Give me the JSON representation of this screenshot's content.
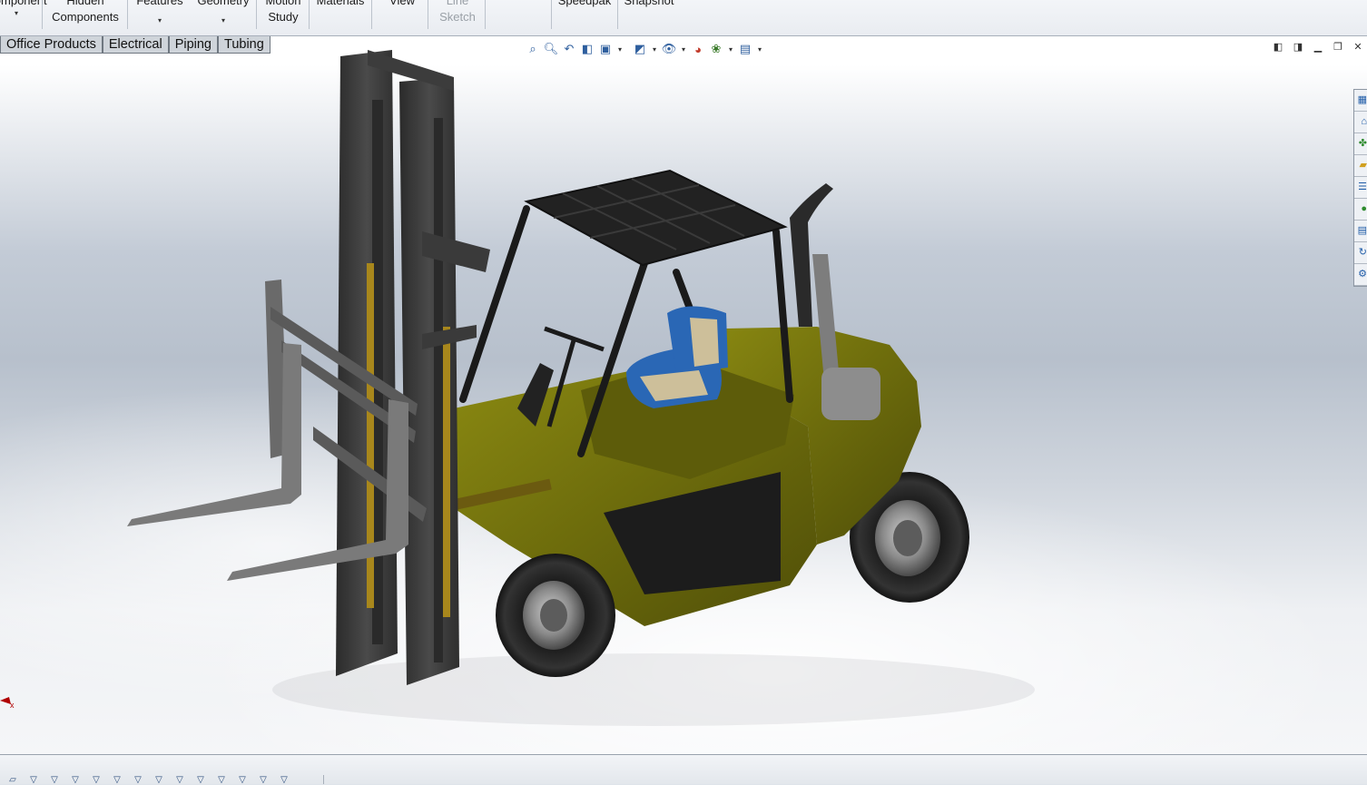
{
  "ribbon": {
    "buttons": [
      {
        "label1": "Component",
        "label2": "",
        "has_dropdown": true,
        "disabled": false
      },
      {
        "label1": "Hidden",
        "label2": "Components",
        "has_dropdown": false,
        "disabled": false
      },
      {
        "label1": "Features",
        "label2": "",
        "has_dropdown": true,
        "disabled": false
      },
      {
        "label1": "Geometry",
        "label2": "",
        "has_dropdown": true,
        "disabled": false
      },
      {
        "label1": "Motion",
        "label2": "Study",
        "has_dropdown": false,
        "disabled": false
      },
      {
        "label1": "Materials",
        "label2": "",
        "has_dropdown": false,
        "disabled": false
      },
      {
        "label1": "View",
        "label2": "",
        "has_dropdown": false,
        "disabled": false
      },
      {
        "label1": "Line",
        "label2": "Sketch",
        "has_dropdown": false,
        "disabled": true
      },
      {
        "label1": "Speedpak",
        "label2": "",
        "has_dropdown": false,
        "disabled": false
      },
      {
        "label1": "Snapshot",
        "label2": "",
        "has_dropdown": false,
        "disabled": false
      }
    ]
  },
  "tabs": [
    "Office Products",
    "Electrical",
    "Piping",
    "Tubing"
  ],
  "hud_icons": [
    "zoom-to-fit-icon",
    "zoom-to-area-icon",
    "previous-view-icon",
    "section-view-icon",
    "view-orientation-icon",
    "display-style-icon",
    "hide-show-items-icon",
    "edit-appearance-icon",
    "apply-scene-icon",
    "view-settings-icon"
  ],
  "window_controls": [
    "tile-left-icon",
    "tile-right-icon",
    "minimize-icon",
    "restore-icon",
    "close-icon"
  ],
  "task_pane": [
    "solidworks-resources-icon",
    "design-library-icon",
    "toolbox-icon",
    "file-explorer-icon",
    "view-palette-icon",
    "appearances-icon",
    "custom-properties-icon",
    "forum-icon",
    "motion-icon"
  ],
  "colors": {
    "body_paint": "#7a7a0e",
    "metal_dark": "#3c3c3c",
    "seat_blue": "#2a67b5",
    "seat_tan": "#cdbf9a"
  }
}
